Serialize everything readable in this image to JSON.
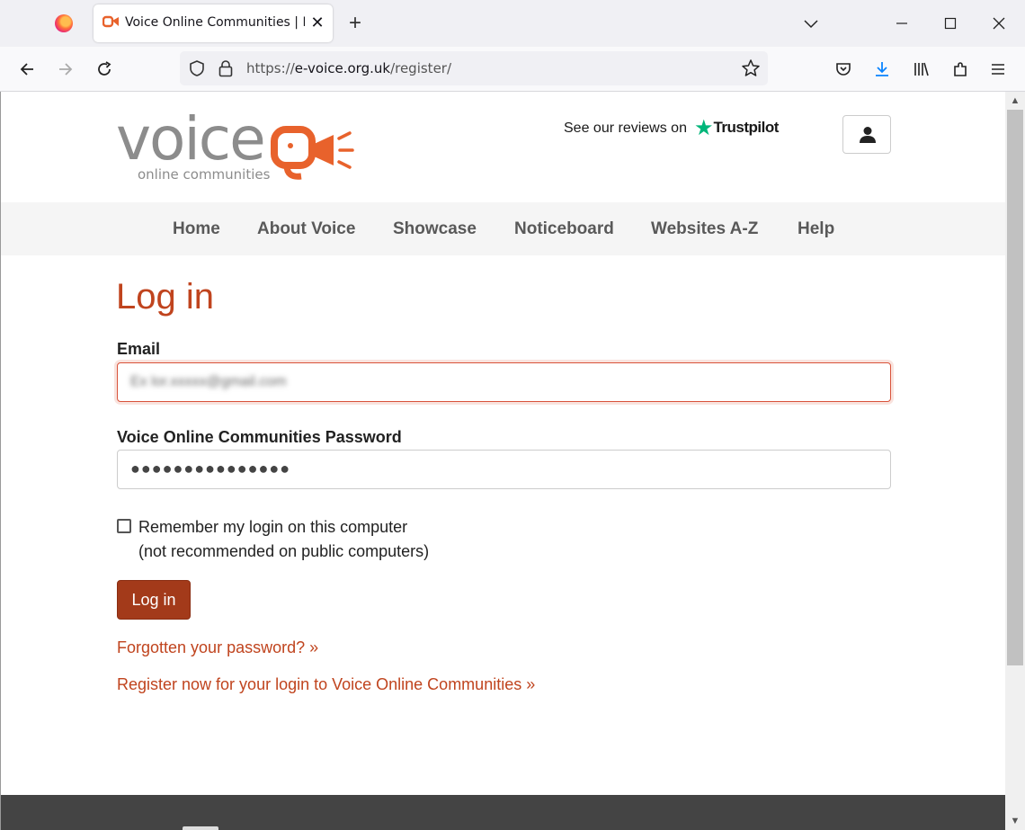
{
  "browser": {
    "tab_title": "Voice Online Communities | Log",
    "url_prefix": "https://",
    "url_host": "e-voice.org.uk",
    "url_path": "/register/"
  },
  "site": {
    "logo_word": "voice",
    "logo_sub": "online communities",
    "trust_text": "See our reviews on",
    "trust_brand": "Trustpilot"
  },
  "nav": {
    "items": [
      {
        "label": "Home"
      },
      {
        "label": "About Voice"
      },
      {
        "label": "Showcase"
      },
      {
        "label": "Noticeboard"
      },
      {
        "label": "Websites A-Z"
      },
      {
        "label": "Help"
      }
    ]
  },
  "form": {
    "title": "Log in",
    "email_label": "Email",
    "email_value": "Ex lor.xxxxx@gmail.com",
    "password_label": "Voice Online Communities Password",
    "password_value": "●●●●●●●●●●●●●●●",
    "remember_label": "Remember my login on this computer",
    "remember_note": "(not recommended on public computers)",
    "submit_label": "Log in",
    "forgot_link": "Forgotten your password? »",
    "register_link": "Register now for your login to Voice Online Communities »"
  },
  "colors": {
    "accent": "#c0441e",
    "button": "#a33a1a",
    "trustpilot": "#00b67a",
    "footer": "#444444"
  },
  "icons": [
    "firefox-icon",
    "voice-favicon-icon",
    "close-icon",
    "plus-icon",
    "chevron-down-icon",
    "minimize-icon",
    "maximize-icon",
    "back-icon",
    "forward-icon",
    "reload-icon",
    "shield-icon",
    "lock-icon",
    "star-icon",
    "pocket-icon",
    "download-icon",
    "library-icon",
    "extensions-icon",
    "menu-icon",
    "user-icon",
    "trustpilot-star-icon"
  ]
}
